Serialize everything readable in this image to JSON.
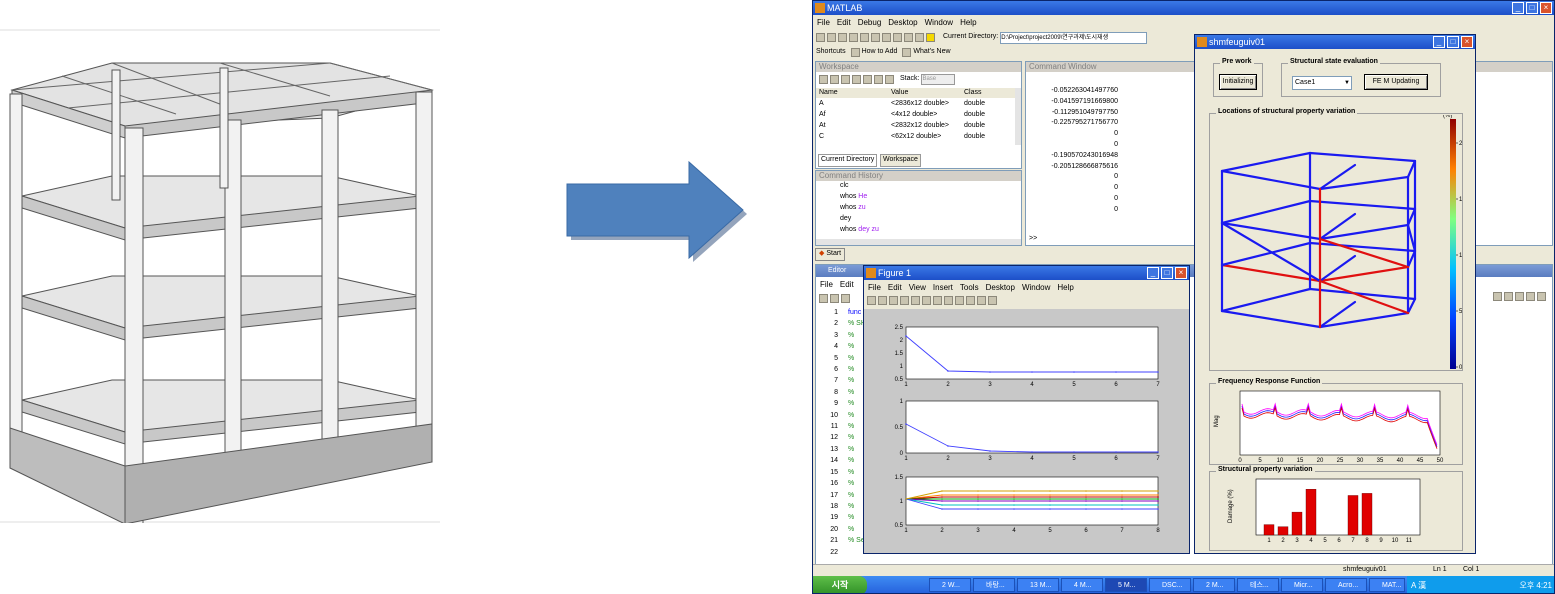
{
  "matlab": {
    "title": "MATLAB",
    "menu": [
      "File",
      "Edit",
      "Debug",
      "Desktop",
      "Window",
      "Help"
    ],
    "current_dir_label": "Current Directory:",
    "current_dir_value": "D:\\Project\\project2009\\연구과제\\도시재생",
    "shortcuts": {
      "label": "Shortcuts",
      "how_to_add": "How to Add",
      "whats_new": "What's New"
    },
    "workspace": {
      "title": "Workspace",
      "stack_label": "Stack:",
      "stack_value": "Base",
      "columns": [
        "Name",
        "Value",
        "Class"
      ],
      "rows": [
        [
          "A",
          "<2836x12 double>",
          "double"
        ],
        [
          "Af",
          "<4x12 double>",
          "double"
        ],
        [
          "At",
          "<2832x12 double>",
          "double"
        ],
        [
          "C",
          "<62x12 double>",
          "double"
        ]
      ],
      "tabs": [
        "Current Directory",
        "Workspace"
      ]
    },
    "command_history": {
      "title": "Command History",
      "lines": [
        {
          "cmd": "clc",
          "arg": ""
        },
        {
          "cmd": "whos",
          "arg": "He"
        },
        {
          "cmd": "whos",
          "arg": "zu"
        },
        {
          "cmd": "dey",
          "arg": ""
        },
        {
          "cmd": "whos",
          "arg": "dey zu"
        }
      ]
    },
    "command_window": {
      "title": "Command Window",
      "values": [
        "-0.052263041497760",
        "-0.041597191669800",
        "-0.112951049797750",
        "-0.225795271756770",
        "0",
        "0",
        "-0.190570243016948",
        "-0.205128666875616",
        "0",
        "0",
        "0",
        "0"
      ],
      "prompt": ">>"
    },
    "start_label": "Start",
    "editor": {
      "title": "Editor",
      "line_numbers": [
        "1",
        "2",
        "3",
        "4",
        "5",
        "6",
        "7",
        "8",
        "9",
        "10",
        "11",
        "12",
        "13",
        "14",
        "15",
        "16",
        "17",
        "18",
        "19",
        "20",
        "21",
        "22"
      ],
      "first_code": "func",
      "first_comment": "% SH",
      "comment_mark": "%",
      "last_comment": "% Se"
    },
    "status": {
      "file": "shmfeuguiv01",
      "ln": "Ln 1",
      "col": "Col 1"
    }
  },
  "figure": {
    "title": "Figure 1",
    "menu": [
      "File",
      "Edit",
      "View",
      "Insert",
      "Tools",
      "Desktop",
      "Window",
      "Help"
    ],
    "plot1": {
      "yticks": [
        "2.5",
        "2",
        "1.5",
        "1",
        "0.5"
      ],
      "xticks": [
        "1",
        "2",
        "3",
        "4",
        "5",
        "6",
        "7"
      ]
    },
    "plot2": {
      "yticks": [
        "1",
        "0.5",
        "0"
      ],
      "xticks": [
        "1",
        "2",
        "3",
        "4",
        "5",
        "6",
        "7"
      ]
    },
    "plot3": {
      "yticks": [
        "1.5",
        "1",
        "0.5"
      ],
      "xticks": [
        "1",
        "2",
        "3",
        "4",
        "5",
        "6",
        "7",
        "8"
      ]
    }
  },
  "gui": {
    "title": "shmfeuguiv01",
    "pre_work_label": "Pre work",
    "initializing_button": "Initializing",
    "state_eval_label": "Structural state evaluation",
    "case_value": "Case1",
    "fem_button": "FE M Updating",
    "locations_label": "Locations of structural property variation",
    "colorbar_unit": "(%)",
    "colorbar_ticks": [
      "20",
      "15",
      "10",
      "5",
      "0"
    ],
    "frf_label": "Frequency Response Function",
    "mag_label": "Mag",
    "frf_xticks": [
      "0",
      "5",
      "10",
      "15",
      "20",
      "25",
      "30",
      "35",
      "40",
      "45",
      "50"
    ],
    "property_label": "Structural property variation",
    "damage_label": "Damage (%)",
    "damage_values": [
      5,
      4,
      11,
      22,
      0,
      0,
      19,
      20,
      0,
      0,
      0
    ]
  },
  "taskbar": {
    "start": "시작",
    "items": [
      "2 W...",
      "바탕...",
      "13 M...",
      "4 M...",
      "5 M...",
      "DSC...",
      "2 M...",
      "테스...",
      "Micr...",
      "Acro...",
      "MAT..."
    ],
    "clock": "오후 4:21",
    "lang": "A 漢"
  },
  "colors": {
    "matlab_blue": "#1d4fc8",
    "arrow": "#4f81bd",
    "frame_blue": "#1a1af0",
    "frame_red": "#e01010",
    "damage_bar": "#e00000"
  }
}
